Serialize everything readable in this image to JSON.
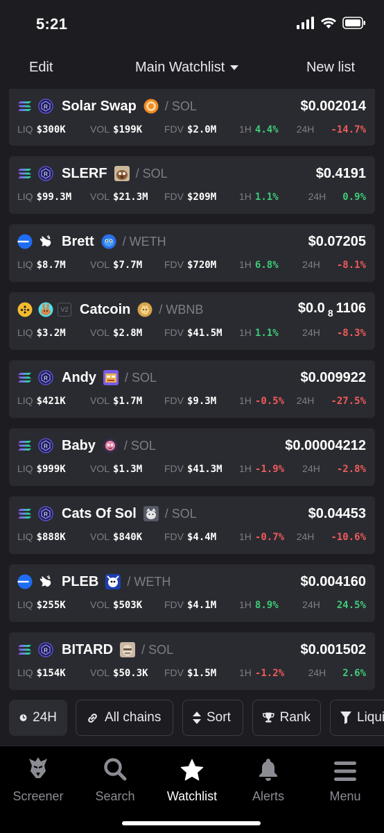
{
  "status": {
    "time": "5:21"
  },
  "nav": {
    "edit": "Edit",
    "title": "Main Watchlist",
    "new_list": "New list"
  },
  "labels": {
    "liq": "LIQ",
    "vol": "VOL",
    "fdv": "FDV",
    "h1": "1H",
    "h24": "24H"
  },
  "tokens": [
    {
      "chain": "solana",
      "dex": "raydium",
      "name": "Solar Swap",
      "logo": "solar-swap-logo",
      "quote": "/ SOL",
      "price": "$0.002014",
      "liq": "$300K",
      "vol": "$199K",
      "fdv": "$2.0M",
      "h1": "4.4%",
      "h24": "-14.7%"
    },
    {
      "chain": "solana",
      "dex": "raydium",
      "name": "SLERF",
      "logo": "slerf-logo",
      "quote": "/ SOL",
      "price": "$0.4191",
      "liq": "$99.3M",
      "vol": "$21.3M",
      "fdv": "$209M",
      "h1": "1.1%",
      "h24": "0.9%"
    },
    {
      "chain": "base",
      "dex": "uniswap",
      "name": "Brett",
      "logo": "brett-logo",
      "quote": "/ WETH",
      "price": "$0.07205",
      "liq": "$8.7M",
      "vol": "$7.7M",
      "fdv": "$720M",
      "h1": "6.8%",
      "h24": "-8.1%"
    },
    {
      "chain": "bsc",
      "dex": "pancakeswap",
      "badge": "V2",
      "name": "Catcoin",
      "logo": "catcoin-logo",
      "quote": "/ WBNB",
      "price": "$0.0",
      "price_sub": "8",
      "price_tail": "1106",
      "liq": "$3.2M",
      "vol": "$2.8M",
      "fdv": "$41.5M",
      "h1": "1.1%",
      "h24": "-8.3%"
    },
    {
      "chain": "solana",
      "dex": "raydium",
      "name": "Andy",
      "logo": "andy-logo",
      "quote": "/ SOL",
      "price": "$0.009922",
      "liq": "$421K",
      "vol": "$1.7M",
      "fdv": "$9.3M",
      "h1": "-0.5%",
      "h24": "-27.5%"
    },
    {
      "chain": "solana",
      "dex": "raydium",
      "name": "Baby",
      "logo": "baby-logo",
      "quote": "/ SOL",
      "price": "$0.00004212",
      "liq": "$999K",
      "vol": "$1.3M",
      "fdv": "$41.3M",
      "h1": "-1.9%",
      "h24": "-2.8%"
    },
    {
      "chain": "solana",
      "dex": "raydium",
      "name": "Cats Of Sol",
      "logo": "cats-of-sol-logo",
      "quote": "/ SOL",
      "price": "$0.04453",
      "liq": "$888K",
      "vol": "$840K",
      "fdv": "$4.4M",
      "h1": "-0.7%",
      "h24": "-10.6%"
    },
    {
      "chain": "base",
      "dex": "uniswap",
      "name": "PLEB",
      "logo": "pleb-logo",
      "quote": "/ WETH",
      "price": "$0.004160",
      "liq": "$255K",
      "vol": "$503K",
      "fdv": "$4.1M",
      "h1": "8.9%",
      "h24": "24.5%"
    },
    {
      "chain": "solana",
      "dex": "raydium",
      "name": "BITARD",
      "logo": "bitard-logo",
      "quote": "/ SOL",
      "price": "$0.001502",
      "liq": "$154K",
      "vol": "$50.3K",
      "fdv": "$1.5M",
      "h1": "-1.2%",
      "h24": "2.6%"
    }
  ],
  "filters": {
    "timeframe": "24H",
    "chains": "All chains",
    "sort": "Sort",
    "rank": "Rank",
    "liquidity": "Liqui"
  },
  "tabs": {
    "screener": "Screener",
    "search": "Search",
    "watchlist": "Watchlist",
    "alerts": "Alerts",
    "menu": "Menu"
  },
  "colors": {
    "positive": "#3ecb78",
    "negative": "#ef5b5b",
    "card": "#2a2b30",
    "background": "#1c1c21"
  }
}
